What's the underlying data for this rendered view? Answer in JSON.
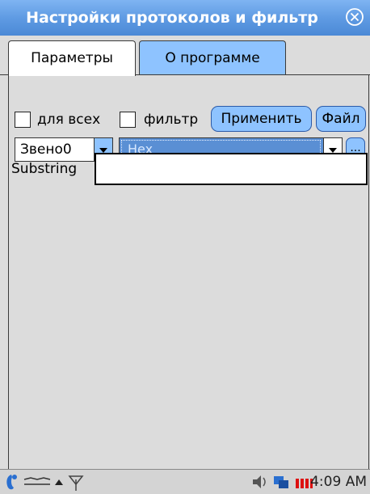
{
  "window": {
    "title": "Настройки протоколов и фильтр"
  },
  "tabs": [
    {
      "label": "Параметры",
      "active": true
    },
    {
      "label": "О программе",
      "active": false
    }
  ],
  "options": {
    "all_label": "для всех",
    "all_checked": false,
    "filter_label": "фильтр",
    "filter_checked": false
  },
  "buttons": {
    "apply_label": "Применить",
    "file_label": "Файл",
    "more_label": "..."
  },
  "combos": {
    "link_value": "Звено0",
    "format_value": "Hex"
  },
  "substring": {
    "label": "Substring",
    "value": ""
  },
  "taskbar": {
    "clock": "4:09 AM"
  },
  "colors": {
    "accent": "#8ec3ff",
    "title_bar": "#5f9be3",
    "selection": "#5a8fd4"
  },
  "icons": [
    "close-icon",
    "start-icon",
    "keyboard-icon",
    "up-arrow-icon",
    "antenna-icon",
    "volume-icon",
    "network-icon",
    "battery-icon",
    "chevron-down-icon"
  ]
}
